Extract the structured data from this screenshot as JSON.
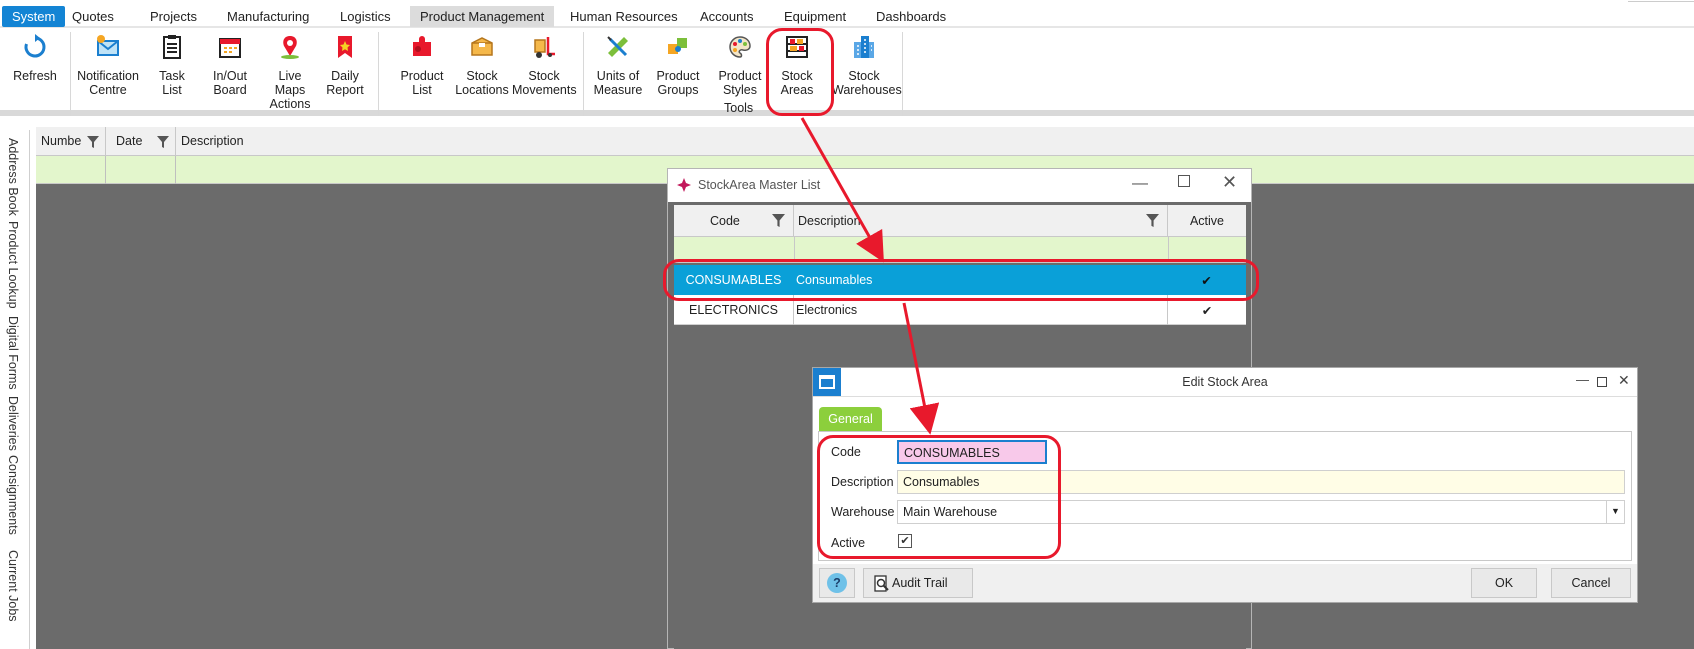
{
  "menu": {
    "tabs": [
      "System",
      "Quotes",
      "Projects",
      "Manufacturing",
      "Logistics",
      "Product Management",
      "Human Resources",
      "Accounts",
      "Equipment",
      "Dashboards"
    ]
  },
  "ribbon": {
    "refresh": "Refresh",
    "notification": "Notification\nCentre",
    "task_list": "Task\nList",
    "inout_board": "In/Out\nBoard",
    "live_maps": "Live\nMaps\nActions",
    "daily_report": "Daily\nReport",
    "product_list": "Product\nList",
    "stock_locations": "Stock\nLocations",
    "stock_movements": "Stock\nMovements",
    "units_of_measure": "Units of\nMeasure",
    "product_groups": "Product\nGroups",
    "product_styles": "Product\nStyles",
    "tools_label": "Tools",
    "stock_areas": "Stock\nAreas",
    "stock_warehouses": "Stock\nWarehouses"
  },
  "sidebar": {
    "items": [
      "Address Book",
      "Product Lookup",
      "Digital Forms",
      "Deliveries",
      "Consignments",
      "Current Jobs"
    ]
  },
  "main_grid": {
    "columns": [
      "Numbe",
      "Date",
      "Description"
    ]
  },
  "stockarea_window": {
    "title": "StockArea Master List",
    "columns": {
      "code": "Code",
      "description": "Description",
      "active": "Active"
    },
    "rows": [
      {
        "code": "CONSUMABLES",
        "description": "Consumables",
        "active": "✔"
      },
      {
        "code": "ELECTRONICS",
        "description": "Electronics",
        "active": "✔"
      }
    ]
  },
  "edit_window": {
    "title": "Edit Stock Area",
    "tab": "General",
    "labels": {
      "code": "Code",
      "description": "Description",
      "warehouse": "Warehouse",
      "active": "Active"
    },
    "values": {
      "code": "CONSUMABLES",
      "description": "Consumables",
      "warehouse": "Main Warehouse",
      "active": "✔"
    },
    "buttons": {
      "help": "?",
      "audit": "Audit Trail",
      "ok": "OK",
      "cancel": "Cancel"
    }
  },
  "colors": {
    "accent": "#1384d4",
    "selected_row": "#0aa0d8",
    "annotation": "#e8192c",
    "filter_row": "#e3f6cc",
    "general_tab": "#8ccf3c"
  }
}
